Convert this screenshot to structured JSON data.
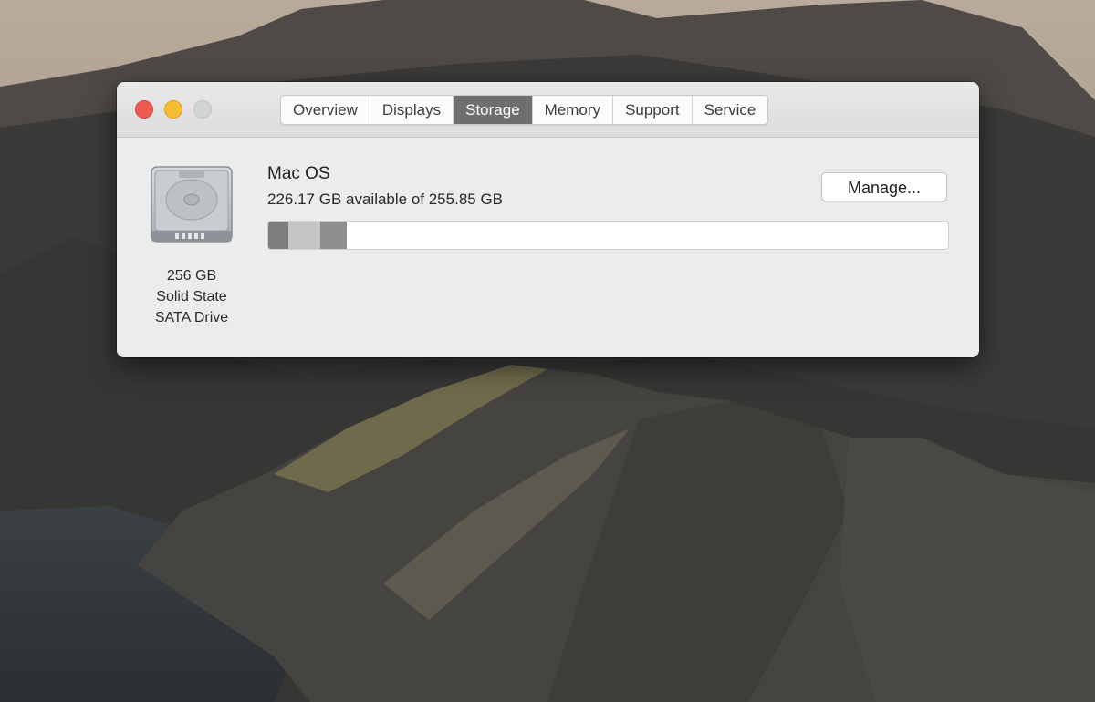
{
  "window": {
    "tabs": [
      {
        "label": "Overview",
        "active": false
      },
      {
        "label": "Displays",
        "active": false
      },
      {
        "label": "Storage",
        "active": true
      },
      {
        "label": "Memory",
        "active": false
      },
      {
        "label": "Support",
        "active": false
      },
      {
        "label": "Service",
        "active": false
      }
    ]
  },
  "disk": {
    "icon": "hard-drive-icon",
    "caption": [
      "256 GB",
      "Solid State",
      "SATA Drive"
    ]
  },
  "volume": {
    "name": "Mac OS",
    "availability": "226.17 GB available of 255.85 GB",
    "manage_label": "Manage...",
    "usage_segments": [
      {
        "fraction": 0.03,
        "color": "#7d7d7d"
      },
      {
        "fraction": 0.046,
        "color": "#c4c4c4"
      },
      {
        "fraction": 0.04,
        "color": "#8f8f8f"
      }
    ]
  },
  "colors": {
    "close": "#ee5b52",
    "minimize": "#f5bd2f",
    "zoom": "#d3d3d3",
    "active_tab": "#6e6e6e"
  }
}
